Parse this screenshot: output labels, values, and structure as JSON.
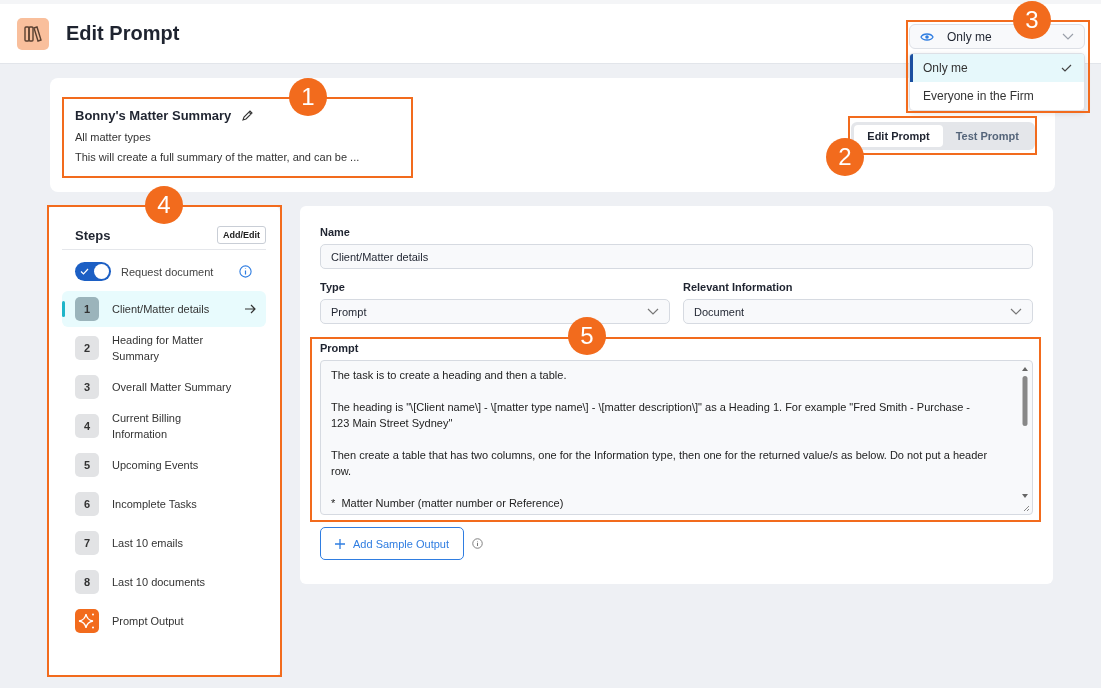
{
  "header": {
    "title": "Edit Prompt"
  },
  "visibility": {
    "value": "Only me",
    "options": [
      {
        "label": "Only me",
        "selected": true
      },
      {
        "label": "Everyone in the Firm",
        "selected": false
      }
    ]
  },
  "prompt_summary": {
    "name": "Bonny's Matter Summary",
    "matter_types": "All matter types",
    "description": "This will create a full summary of the matter, and can be ..."
  },
  "mode_tabs": [
    {
      "label": "Edit Prompt",
      "selected": true
    },
    {
      "label": "Test Prompt",
      "selected": false
    }
  ],
  "steps_panel": {
    "title": "Steps",
    "add_button": "Add/Edit",
    "request_document": {
      "label": "Request document",
      "on": true
    },
    "steps": [
      {
        "kind": "number",
        "badge": "1",
        "label": "Client/Matter details",
        "selected": true
      },
      {
        "kind": "number",
        "badge": "2",
        "label": "Heading for Matter Summary",
        "selected": false
      },
      {
        "kind": "number",
        "badge": "3",
        "label": "Overall Matter Summary",
        "selected": false
      },
      {
        "kind": "number",
        "badge": "4",
        "label": "Current Billing Information",
        "selected": false
      },
      {
        "kind": "number",
        "badge": "5",
        "label": "Upcoming Events",
        "selected": false
      },
      {
        "kind": "number",
        "badge": "6",
        "label": "Incomplete Tasks",
        "selected": false
      },
      {
        "kind": "number",
        "badge": "7",
        "label": "Last 10 emails",
        "selected": false
      },
      {
        "kind": "number",
        "badge": "8",
        "label": "Last 10 documents",
        "selected": false
      },
      {
        "kind": "output",
        "label": "Prompt Output",
        "selected": false
      }
    ]
  },
  "step_form": {
    "name": {
      "label": "Name",
      "value": "Client/Matter details"
    },
    "type": {
      "label": "Type",
      "value": "Prompt"
    },
    "relevant_information": {
      "label": "Relevant Information",
      "value": "Document"
    },
    "prompt": {
      "label": "Prompt",
      "value": "The task is to create a heading and then a table.\n\nThe heading is \"\\[Client name\\] - \\[matter type name\\] - \\[matter description\\]\" as a Heading 1. For example \"Fred Smith - Purchase - 123 Main Street Sydney\"\n\nThen create a table that has two columns, one for the Information type, then one for the returned value/s as below. Do not put a header row.\n\n*  Matter Number (matter number or Reference)"
    },
    "add_sample_button": "Add Sample Output"
  },
  "callouts": [
    {
      "label": "1"
    },
    {
      "label": "2"
    },
    {
      "label": "3"
    },
    {
      "label": "4"
    },
    {
      "label": "5"
    }
  ]
}
